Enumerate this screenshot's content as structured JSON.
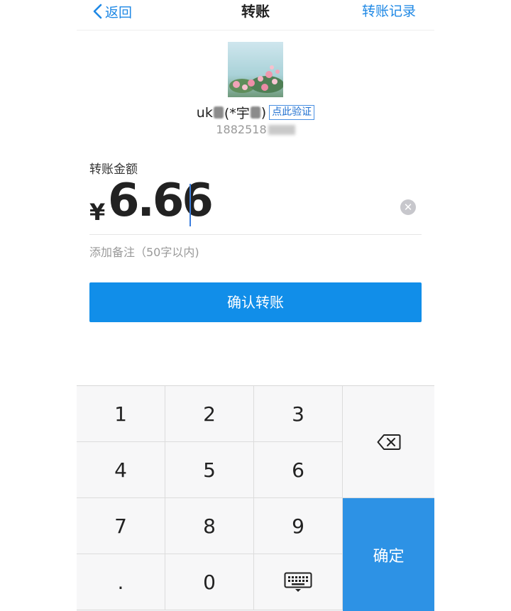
{
  "nav": {
    "back_label": "返回",
    "title": "转账",
    "right_label": "转账记录"
  },
  "recipient": {
    "name_prefix": "uk",
    "name_mid": "(*宇",
    "name_suffix": ")",
    "verify_label": "点此验证",
    "phone_visible": "1882518"
  },
  "amount": {
    "label": "转账金额",
    "currency": "¥",
    "value": "6.66"
  },
  "remark": {
    "placeholder": "添加备注（50字以内)"
  },
  "confirm_label": "确认转账",
  "keypad": {
    "keys": [
      "1",
      "2",
      "3",
      "4",
      "5",
      "6",
      "7",
      "8",
      "9",
      ".",
      "0"
    ],
    "ok_label": "确定"
  },
  "colors": {
    "accent": "#118ee9",
    "ok_key": "#2d92e5",
    "link": "#1e88e5"
  }
}
